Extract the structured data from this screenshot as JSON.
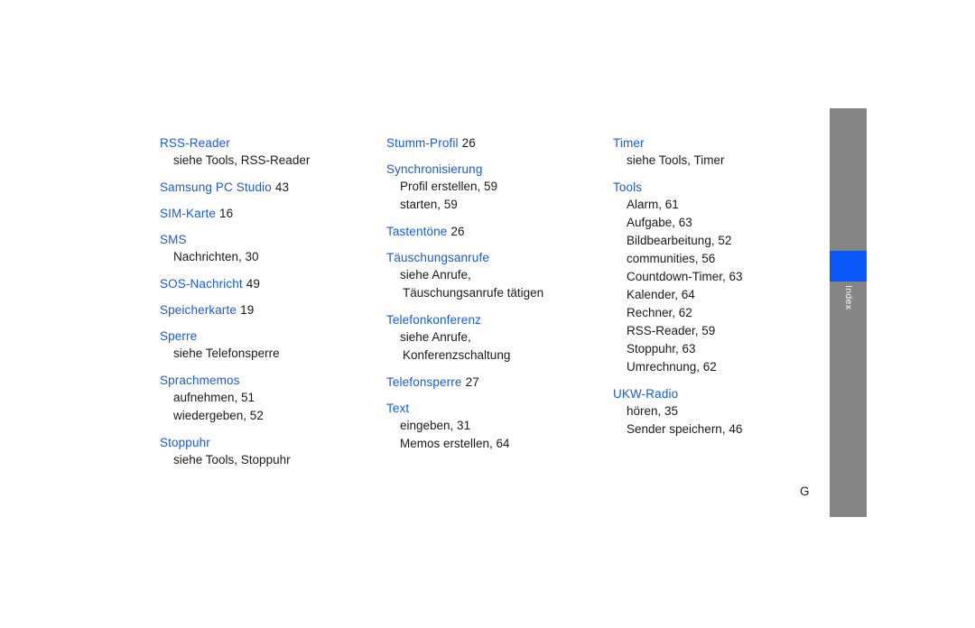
{
  "page": {
    "marker": "G",
    "background_color": "#ffffff",
    "heading_color": "#1759E8",
    "text_color": "#1a1a1a"
  },
  "side_tab": {
    "label": "Index",
    "bar_color": "#858585",
    "highlight_color": "#0A57F7",
    "label_color": "#ffffff"
  },
  "columns": [
    {
      "entries": [
        {
          "term": "RSS-Reader",
          "page": "",
          "subs": [
            {
              "text": "siehe Tools, RSS-Reader",
              "continuation": false
            }
          ]
        },
        {
          "term": "Samsung PC Studio",
          "page": "43",
          "subs": []
        },
        {
          "term": "SIM-Karte",
          "page": "16",
          "subs": []
        },
        {
          "term": "SMS",
          "page": "",
          "subs": [
            {
              "text": "Nachrichten, 30",
              "continuation": false
            }
          ]
        },
        {
          "term": "SOS-Nachricht",
          "page": "49",
          "subs": []
        },
        {
          "term": "Speicherkarte",
          "page": "19",
          "subs": []
        },
        {
          "term": "Sperre",
          "page": "",
          "subs": [
            {
              "text": "siehe Telefonsperre",
              "continuation": false
            }
          ]
        },
        {
          "term": "Sprachmemos",
          "page": "",
          "subs": [
            {
              "text": "aufnehmen, 51",
              "continuation": false
            },
            {
              "text": "wiedergeben, 52",
              "continuation": false
            }
          ]
        },
        {
          "term": "Stoppuhr",
          "page": "",
          "subs": [
            {
              "text": "siehe Tools, Stoppuhr",
              "continuation": false
            }
          ]
        }
      ]
    },
    {
      "entries": [
        {
          "term": "Stumm-Profil",
          "page": "26",
          "subs": []
        },
        {
          "term": "Synchronisierung",
          "page": "",
          "subs": [
            {
              "text": "Profil erstellen, 59",
              "continuation": false
            },
            {
              "text": "starten, 59",
              "continuation": false
            }
          ]
        },
        {
          "term": "Tastentöne",
          "page": "26",
          "subs": []
        },
        {
          "term": "Täuschungsanrufe",
          "page": "",
          "subs": [
            {
              "text": "siehe Anrufe,",
              "continuation": false
            },
            {
              "text": "Täuschungsanrufe tätigen",
              "continuation": true
            }
          ]
        },
        {
          "term": "Telefonkonferenz",
          "page": "",
          "subs": [
            {
              "text": "siehe Anrufe,",
              "continuation": false
            },
            {
              "text": "Konferenzschaltung",
              "continuation": true
            }
          ]
        },
        {
          "term": "Telefonsperre",
          "page": "27",
          "subs": []
        },
        {
          "term": "Text",
          "page": "",
          "subs": [
            {
              "text": "eingeben, 31",
              "continuation": false
            },
            {
              "text": "Memos erstellen, 64",
              "continuation": false
            }
          ]
        }
      ]
    },
    {
      "entries": [
        {
          "term": "Timer",
          "page": "",
          "subs": [
            {
              "text": "siehe Tools, Timer",
              "continuation": false
            }
          ]
        },
        {
          "term": "Tools",
          "page": "",
          "subs": [
            {
              "text": "Alarm, 61",
              "continuation": false
            },
            {
              "text": "Aufgabe, 63",
              "continuation": false
            },
            {
              "text": "Bildbearbeitung, 52",
              "continuation": false
            },
            {
              "text": "communities, 56",
              "continuation": false
            },
            {
              "text": "Countdown-Timer, 63",
              "continuation": false
            },
            {
              "text": "Kalender, 64",
              "continuation": false
            },
            {
              "text": "Rechner, 62",
              "continuation": false
            },
            {
              "text": "RSS-Reader, 59",
              "continuation": false
            },
            {
              "text": "Stoppuhr, 63",
              "continuation": false
            },
            {
              "text": "Umrechnung, 62",
              "continuation": false
            }
          ]
        },
        {
          "term": "UKW-Radio",
          "page": "",
          "subs": [
            {
              "text": "hören, 35",
              "continuation": false
            },
            {
              "text": "Sender speichern, 46",
              "continuation": false
            }
          ]
        }
      ]
    }
  ]
}
